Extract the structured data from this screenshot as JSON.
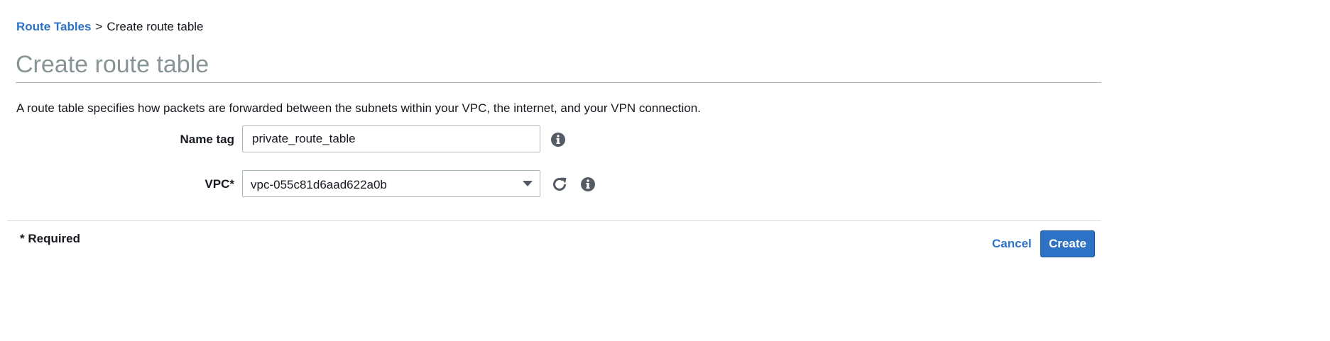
{
  "breadcrumb": {
    "parent_label": "Route Tables",
    "separator": ">",
    "current_label": "Create route table"
  },
  "page": {
    "title": "Create route table",
    "description": "A route table specifies how packets are forwarded between the subnets within your VPC, the internet, and your VPN connection."
  },
  "form": {
    "name_tag": {
      "label": "Name tag",
      "value": "private_route_table",
      "info_icon": "info-icon"
    },
    "vpc": {
      "label": "VPC*",
      "selected_value": "vpc-055c81d6aad622a0b",
      "refresh_icon": "refresh-icon",
      "info_icon": "info-icon"
    }
  },
  "footer": {
    "required_note": "* Required",
    "cancel_label": "Cancel",
    "create_label": "Create"
  },
  "colors": {
    "link": "#2e73c4",
    "primary_button": "#2d72c4",
    "title_gray": "#879596",
    "text": "#16191f"
  }
}
